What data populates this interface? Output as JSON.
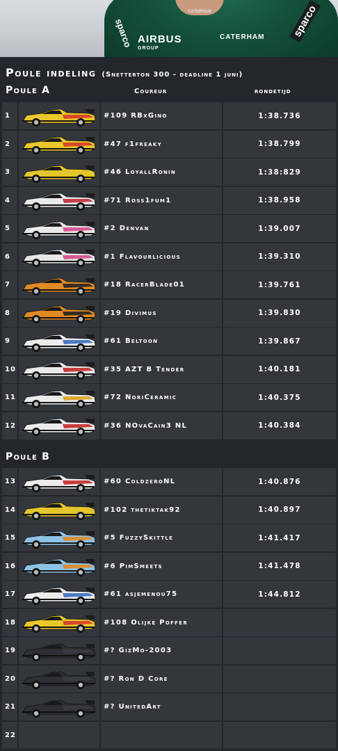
{
  "header": {
    "sponsor_sparco_left": "sparco",
    "sponsor_airbus": "AIRBUS",
    "sponsor_group": "GROUP",
    "sponsor_caterham_small": "CATERHAM",
    "sponsor_caterham": "CATERHAM",
    "sponsor_sparco_right": "sparco"
  },
  "title": "Poule indeling",
  "subtitle": "(Snetterton 300 - deadline 1 juni)",
  "columns": {
    "driver": "Coureur",
    "laptime": "rondetijd"
  },
  "poule_a": {
    "label": "Poule A",
    "rows": [
      {
        "pos": "1",
        "driver": "#109 RBxGino",
        "time": "1:38.736",
        "body": "#e8c82a",
        "accent": "#d63a2a"
      },
      {
        "pos": "2",
        "driver": "#47 f1freaky",
        "time": "1:38.799",
        "body": "#e8c82a",
        "accent": "#d63a2a"
      },
      {
        "pos": "3",
        "driver": "#46 LoyallRonin",
        "time": "1:38:829",
        "body": "#e3c52c",
        "accent": "#e3c52c"
      },
      {
        "pos": "4",
        "driver": "#71 Ross1fum1",
        "time": "1:38.958",
        "body": "#e9e9e9",
        "accent": "#c0303a"
      },
      {
        "pos": "5",
        "driver": "#2 Denvan",
        "time": "1:39.007",
        "body": "#eaeaea",
        "accent": "#d44a8a"
      },
      {
        "pos": "6",
        "driver": "#1 Flavourlicious",
        "time": "1:39.310",
        "body": "#e7e7e7",
        "accent": "#d44a8a"
      },
      {
        "pos": "7",
        "driver": "#18 RacerBlade01",
        "time": "1:39.761",
        "body": "#e08a24",
        "accent": "#222222"
      },
      {
        "pos": "8",
        "driver": "#19 Divimus",
        "time": "1:39.830",
        "body": "#e08a24",
        "accent": "#222222"
      },
      {
        "pos": "9",
        "driver": "#61 Beltoon",
        "time": "1:39.867",
        "body": "#ececec",
        "accent": "#3a6fc0"
      },
      {
        "pos": "10",
        "driver": "#35 AZT B Tender",
        "time": "1:40.181",
        "body": "#e9e9e9",
        "accent": "#c42a2a"
      },
      {
        "pos": "11",
        "driver": "#72 NoriCeramic",
        "time": "1:40.375",
        "body": "#ececec",
        "accent": "#e0a020"
      },
      {
        "pos": "12",
        "driver": "#36 NOvaCain3 NL",
        "time": "1:40.384",
        "body": "#ececec",
        "accent": "#c42a2a"
      }
    ]
  },
  "poule_b": {
    "label": "Poule B",
    "rows": [
      {
        "pos": "13",
        "driver": "#60 ColdzeroNL",
        "time": "1:40.876",
        "body": "#ececec",
        "accent": "#c42a2a"
      },
      {
        "pos": "14",
        "driver": "#102 thetiktak92",
        "time": "1:40.897",
        "body": "#e3c52c",
        "accent": "#e3c52c"
      },
      {
        "pos": "15",
        "driver": "#5 FuzzySkittle",
        "time": "1:41.417",
        "body": "#8fc3e6",
        "accent": "#e08a24"
      },
      {
        "pos": "16",
        "driver": "#6 PimSmeets",
        "time": "1:41.478",
        "body": "#8fc3e6",
        "accent": "#e08a24"
      },
      {
        "pos": "17",
        "driver": "#61 asjemenou75",
        "time": "1:44.812",
        "body": "#ececec",
        "accent": "#3a6fc0"
      },
      {
        "pos": "18",
        "driver": "#108 Olijke Poffer",
        "time": "",
        "body": "#e8c82a",
        "accent": "#d63a2a"
      },
      {
        "pos": "19",
        "driver": "#? GizMo-2003",
        "time": "",
        "body": "#2c2f33",
        "accent": "#3a3d42"
      },
      {
        "pos": "20",
        "driver": "#? Ron D Core",
        "time": "",
        "body": "#2c2f33",
        "accent": "#3a3d42"
      },
      {
        "pos": "21",
        "driver": "#? UnitedArt",
        "time": "",
        "body": "#2c2f33",
        "accent": "#3a3d42"
      },
      {
        "pos": "22",
        "driver": "",
        "time": "",
        "body": "",
        "accent": ""
      }
    ]
  }
}
